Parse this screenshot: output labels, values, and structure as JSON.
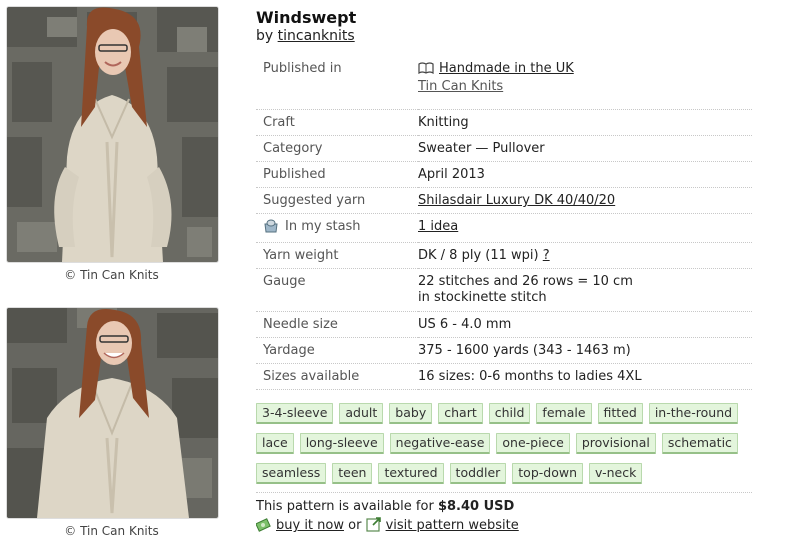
{
  "photos": [
    {
      "credit": "© Tin Can Knits"
    },
    {
      "credit": "© Tin Can Knits"
    }
  ],
  "pattern": {
    "title": "Windswept",
    "by_prefix": "by",
    "author": "tincanknits"
  },
  "details": {
    "published_label": "Published in",
    "published_book": "Handmade in the UK",
    "published_source": "Tin Can Knits",
    "craft_label": "Craft",
    "craft": "Knitting",
    "category_label": "Category",
    "category": "Sweater — Pullover",
    "published_date_label": "Published",
    "published_date": "April 2013",
    "yarn_label": "Suggested yarn",
    "yarn": "Shilasdair Luxury DK 40/40/20",
    "stash_label": "In my stash",
    "stash": "1 idea",
    "weight_label": "Yarn weight",
    "weight": "DK / 8 ply (11 wpi)",
    "weight_help": "?",
    "gauge_label": "Gauge",
    "gauge_line1": "22 stitches and 26 rows = 10 cm",
    "gauge_line2": "in stockinette stitch",
    "needle_label": "Needle size",
    "needle": "US 6 - 4.0 mm",
    "yardage_label": "Yardage",
    "yardage": "375 - 1600 yards (343 - 1463 m)",
    "sizes_label": "Sizes available",
    "sizes": "16 sizes: 0-6 months to ladies 4XL"
  },
  "tags": [
    "3-4-sleeve",
    "adult",
    "baby",
    "chart",
    "child",
    "female",
    "fitted",
    "in-the-round",
    "lace",
    "long-sleeve",
    "negative-ease",
    "one-piece",
    "provisional",
    "schematic",
    "seamless",
    "teen",
    "textured",
    "toddler",
    "top-down",
    "v-neck"
  ],
  "purchase": {
    "text": "This pattern is available for",
    "price": "$8.40 USD",
    "buy_label": "buy it now",
    "or": "or",
    "website_label": "visit pattern website"
  },
  "icons": {
    "book": "book-icon",
    "stash": "stash-icon",
    "money": "money-icon",
    "external": "external-link-icon"
  },
  "colors": {
    "tag_bg": "#e3f5dc",
    "tag_border": "#96c088"
  }
}
